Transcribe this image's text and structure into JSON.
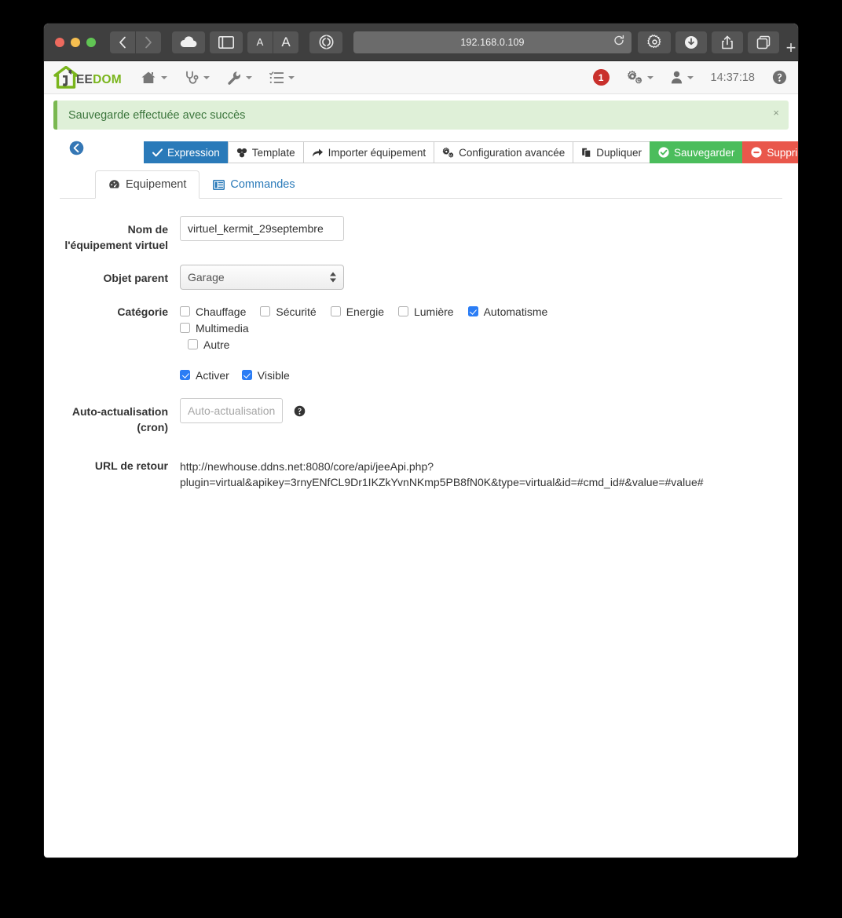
{
  "browser": {
    "url": "192.168.0.109",
    "icons": {
      "back": "back-arrow-icon",
      "forward": "forward-arrow-icon",
      "cloud": "cloud-icon",
      "sidebar": "sidebar-icon",
      "text_small": "A",
      "text_large": "A",
      "reader": "reader-icon",
      "reload": "reload-icon",
      "settings": "gear-icon",
      "download": "download-icon",
      "share": "share-icon",
      "tabs": "tab-overview-icon",
      "new_tab": "+"
    }
  },
  "header": {
    "logo": {
      "ee": "EE",
      "dom": "DOM"
    },
    "nav": [
      {
        "name": "home",
        "icon": "home-icon"
      },
      {
        "name": "health",
        "icon": "stethoscope-icon"
      },
      {
        "name": "tools",
        "icon": "wrench-icon"
      },
      {
        "name": "plugins",
        "icon": "list-icon"
      }
    ],
    "notification_count": "1",
    "gear_menu_icon": "gears-icon",
    "user_menu_icon": "user-icon",
    "clock": "14:37:18",
    "help_icon": "help-circle-icon"
  },
  "alert": {
    "message": "Sauvegarde effectuée avec succès",
    "close_label": "×",
    "bg_color": "#dff0d8",
    "text_color": "#3c763d",
    "border_color": "#7ab851"
  },
  "toolbar": {
    "back_icon": "circle-back-arrow-icon",
    "buttons": [
      {
        "label": "Expression",
        "icon": "check-icon",
        "style": "primary"
      },
      {
        "label": "Template",
        "icon": "template-icon",
        "style": "default"
      },
      {
        "label": "Importer équipement",
        "icon": "share-arrow-icon",
        "style": "default"
      },
      {
        "label": "Configuration avancée",
        "icon": "gears-icon",
        "style": "default"
      },
      {
        "label": "Dupliquer",
        "icon": "copy-icon",
        "style": "default"
      },
      {
        "label": "Sauvegarder",
        "icon": "check-circle-icon",
        "style": "success"
      },
      {
        "label": "Supprimer",
        "icon": "minus-circle-icon",
        "style": "danger"
      }
    ]
  },
  "tabs": [
    {
      "label": "Equipement",
      "icon": "dashboard-icon",
      "active": true
    },
    {
      "label": "Commandes",
      "icon": "table-icon",
      "active": false
    }
  ],
  "form": {
    "name": {
      "label": "Nom de l'équipement virtuel",
      "value": "virtuel_kermit_29septembre"
    },
    "parent": {
      "label": "Objet parent",
      "value": "Garage"
    },
    "category": {
      "label": "Catégorie",
      "items": [
        {
          "label": "Chauffage",
          "checked": false
        },
        {
          "label": "Sécurité",
          "checked": false
        },
        {
          "label": "Energie",
          "checked": false
        },
        {
          "label": "Lumière",
          "checked": false
        },
        {
          "label": "Automatisme",
          "checked": true
        },
        {
          "label": "Multimedia",
          "checked": false
        },
        {
          "label": "Autre",
          "checked": false
        }
      ]
    },
    "toggles": [
      {
        "label": "Activer",
        "checked": true
      },
      {
        "label": "Visible",
        "checked": true
      }
    ],
    "cron": {
      "label": "Auto-actualisation (cron)",
      "value": "",
      "placeholder": "Auto-actualisation (cron)",
      "help_icon": "help-circle-icon"
    },
    "return_url": {
      "label": "URL de retour",
      "value": "http://newhouse.ddns.net:8080/core/api/jeeApi.php?plugin=virtual&apikey=3rnyENfCL9Dr1IKZkYvnNKmp5PB8fN0K&type=virtual&id=#cmd_id#&value=#value#"
    }
  }
}
